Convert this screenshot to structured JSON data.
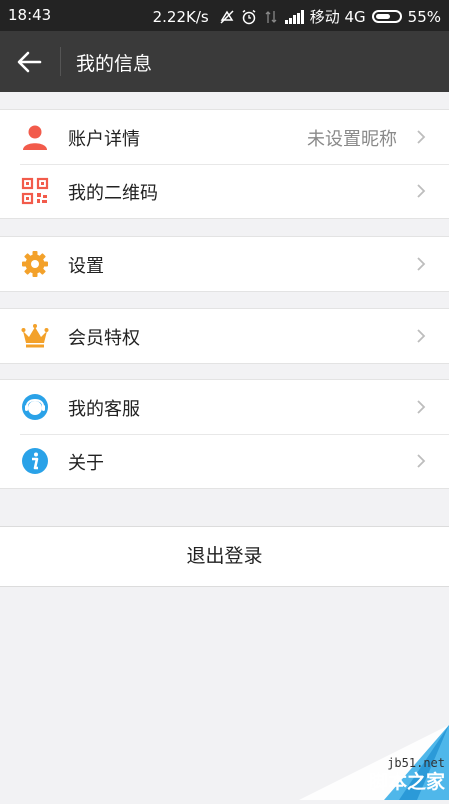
{
  "status_bar": {
    "time": "18:43",
    "speed": "2.22K/s",
    "carrier": "移动 4G",
    "battery": "55%"
  },
  "header": {
    "title": "我的信息"
  },
  "menu_groups": [
    [
      {
        "label": "账户详情",
        "value": "未设置昵称",
        "icon": "person-icon",
        "color": "#f25b4b"
      },
      {
        "label": "我的二维码",
        "value": "",
        "icon": "qr-code-icon",
        "color": "#f25b4b"
      }
    ],
    [
      {
        "label": "设置",
        "value": "",
        "icon": "gear-icon",
        "color": "#f3a12a"
      }
    ],
    [
      {
        "label": "会员特权",
        "value": "",
        "icon": "crown-icon",
        "color": "#f3a12a"
      }
    ],
    [
      {
        "label": "我的客服",
        "value": "",
        "icon": "customer-service-icon",
        "color": "#2aa2e8"
      },
      {
        "label": "关于",
        "value": "",
        "icon": "info-icon",
        "color": "#2aa2e8"
      }
    ]
  ],
  "logout_label": "退出登录",
  "watermark": {
    "site": "jb51.net",
    "name": "脚本之家"
  }
}
